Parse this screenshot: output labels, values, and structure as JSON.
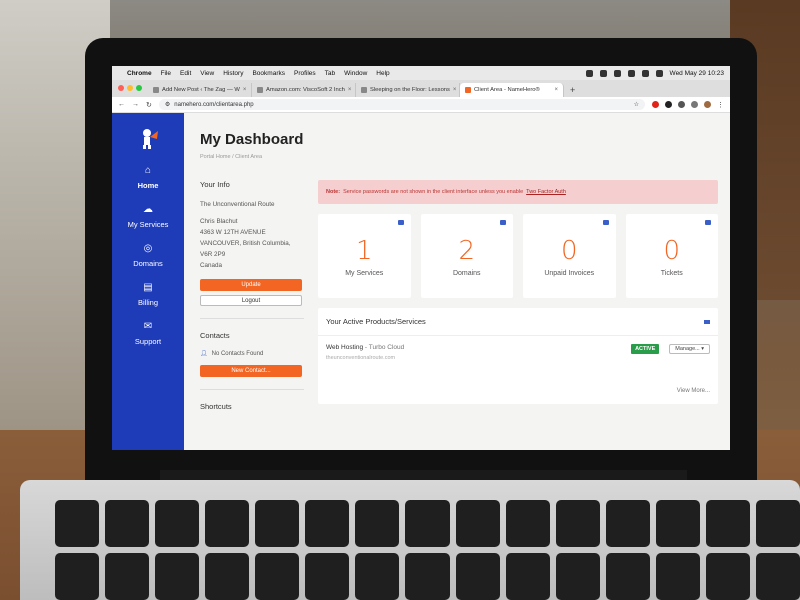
{
  "menubar": {
    "app": "Chrome",
    "items": [
      "File",
      "Edit",
      "View",
      "History",
      "Bookmarks",
      "Profiles",
      "Tab",
      "Window",
      "Help"
    ],
    "clock": "Wed May 29  10:23"
  },
  "tabs": [
    {
      "label": "Add New Post ‹ The Zag — W",
      "active": false
    },
    {
      "label": "Amazon.com: ViscoSoft 2 Inch",
      "active": false
    },
    {
      "label": "Sleeping on the Floor: Lessons",
      "active": false
    },
    {
      "label": "Client Area - NameHero®",
      "active": true
    }
  ],
  "address": {
    "url": "namehero.com/clientarea.php"
  },
  "sidebar": {
    "items": [
      {
        "label": "Home",
        "icon": "home-icon",
        "glyph": "⌂"
      },
      {
        "label": "My Services",
        "icon": "cloud-icon",
        "glyph": "☁"
      },
      {
        "label": "Domains",
        "icon": "globe-icon",
        "glyph": "◎"
      },
      {
        "label": "Billing",
        "icon": "document-icon",
        "glyph": "▤"
      },
      {
        "label": "Support",
        "icon": "mail-icon",
        "glyph": "✉"
      }
    ]
  },
  "page": {
    "title": "My Dashboard",
    "breadcrumb": "Portal Home / Client Area"
  },
  "info": {
    "heading": "Your Info",
    "company": "The Unconventional Route",
    "name": "Chris Blachut",
    "address1": "4363 W 12TH AVENUE",
    "address2": "VANCOUVER, British Columbia,",
    "postal": "V6R 2P9",
    "country": "Canada",
    "update_label": "Update",
    "logout_label": "Logout"
  },
  "contacts": {
    "heading": "Contacts",
    "empty": "No Contacts Found",
    "new_label": "New Contact..."
  },
  "shortcuts": {
    "heading": "Shortcuts"
  },
  "alert": {
    "prefix": "Note:",
    "text": "Service passwords are not shown in the client interface unless you enable",
    "link": "Two Factor Auth"
  },
  "stats": [
    {
      "value": "1",
      "label": "My Services"
    },
    {
      "value": "2",
      "label": "Domains"
    },
    {
      "value": "0",
      "label": "Unpaid Invoices"
    },
    {
      "value": "0",
      "label": "Tickets"
    }
  ],
  "products": {
    "heading": "Your Active Products/Services",
    "item": {
      "name": "Web Hosting",
      "plan": " - Turbo Cloud",
      "domain": "theunconventionalroute.com",
      "status": "ACTIVE",
      "manage_label": "Manage... ▾"
    },
    "view_more": "View More..."
  },
  "colors": {
    "sidebar": "#1e3bb8",
    "accent": "#f26522",
    "active_badge": "#2a9d4a"
  }
}
